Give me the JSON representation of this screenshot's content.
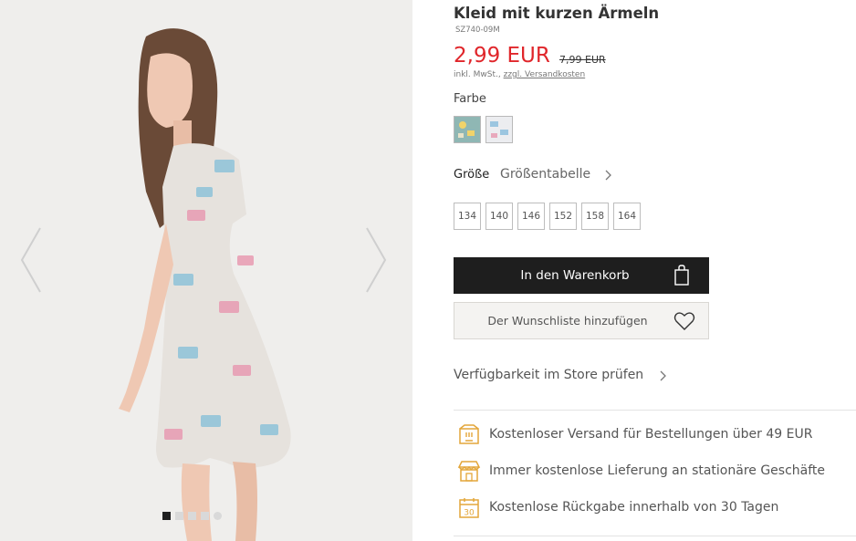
{
  "product": {
    "title": "Kleid mit kurzen Ärmeln",
    "sku": "SZ740-09M",
    "price": "2,99 EUR",
    "old_price": "7,99 EUR",
    "tax_note": "inkl. MwSt.,",
    "shipping_link": "zzgl. Versandkosten"
  },
  "colors": {
    "label": "Farbe",
    "swatches": [
      "mint-print",
      "light-grey-print"
    ]
  },
  "sizes": {
    "label": "Größe",
    "guide": "Größentabelle",
    "options": [
      "134",
      "140",
      "146",
      "152",
      "158",
      "164"
    ]
  },
  "actions": {
    "add_to_cart": "In den Warenkorb",
    "add_to_wishlist": "Der Wunschliste hinzufügen",
    "store_availability": "Verfügbarkeit im Store prüfen"
  },
  "benefits": [
    {
      "icon": "shipping-box-icon",
      "text": "Kostenloser Versand für Bestellungen über 49 EUR"
    },
    {
      "icon": "storefront-icon",
      "text": "Immer kostenlose Lieferung an stationäre Geschäfte"
    },
    {
      "icon": "calendar-30-icon",
      "text": "Kostenlose Rückgabe innerhalb von 30 Tagen",
      "badge": "30"
    }
  ],
  "gallery": {
    "images_count": 5,
    "active_index": 0
  },
  "theme": {
    "price_color": "#e0262b",
    "button_dark": "#1e1e1e",
    "icon_accent": "#e3a63a"
  }
}
